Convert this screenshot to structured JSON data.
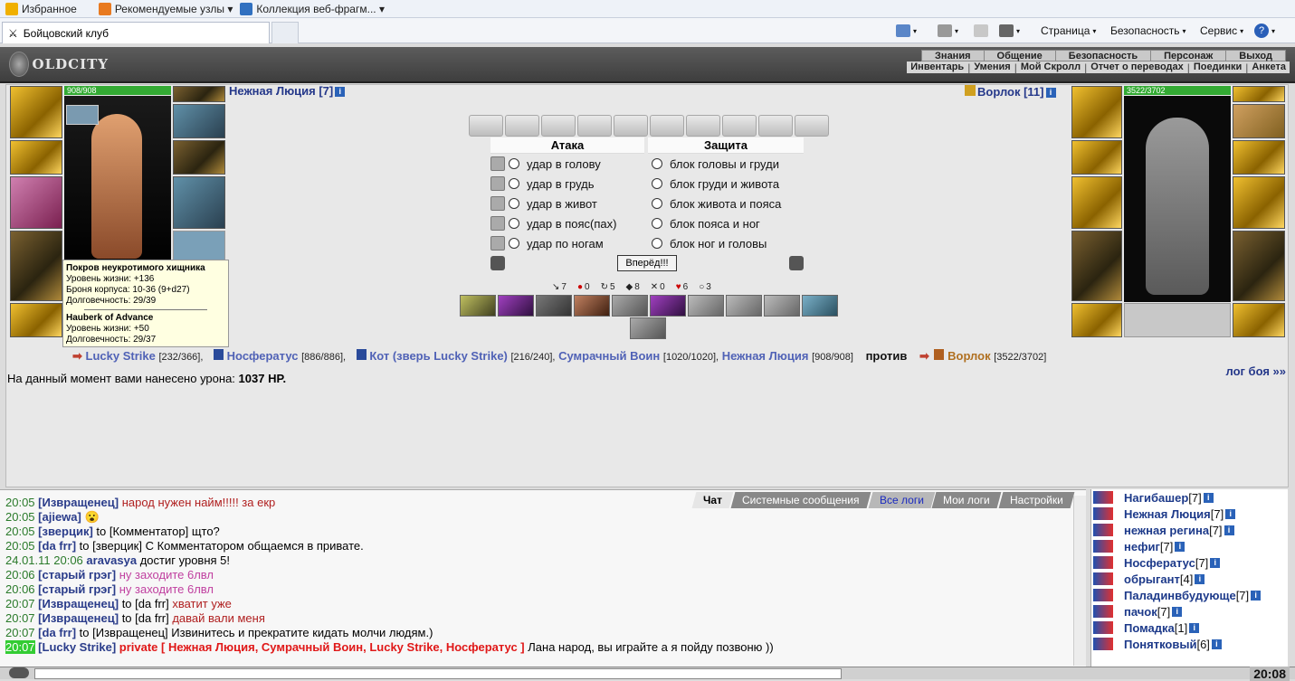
{
  "ie": {
    "favorites": "Избранное",
    "recommended": "Рекомендуемые узлы",
    "webslices": "Коллекция веб-фрагм...",
    "tab_title": "Бойцовский клуб",
    "cmd_page": "Страница",
    "cmd_security": "Безопасность",
    "cmd_service": "Сервис"
  },
  "game": {
    "logo": "OLDCITY",
    "menu_top": [
      "Знания",
      "Общение",
      "Безопасность",
      "Персонаж",
      "Выход"
    ],
    "menu_bottom": [
      "Инвентарь",
      "Умения",
      "Мой Скролл",
      "Отчет о переводах",
      "Поединки",
      "Анкета"
    ]
  },
  "player": {
    "name": "Нежная Люция [7]",
    "hp": "908/908"
  },
  "enemy": {
    "name": "Ворлок [11]",
    "hp": "3522/3702"
  },
  "combat": {
    "attack_header": "Атака",
    "defense_header": "Защита",
    "attacks": [
      "удар в голову",
      "удар в грудь",
      "удар в живот",
      "удар в пояс(пах)",
      "удар по ногам"
    ],
    "blocks": [
      "блок головы и груди",
      "блок груди и живота",
      "блок живота и пояса",
      "блок пояса и ног",
      "блок ног и головы"
    ],
    "go_button": "Вперёд!!!",
    "stats": [
      "7",
      "0",
      "5",
      "8",
      "0",
      "6",
      "3"
    ]
  },
  "tooltip": {
    "item1_title": "Покров неукротимого хищника",
    "item1_lines": [
      "Уровень жизни: +136",
      "Броня корпуса: 10-36 (9+d27)",
      "Долговечность: 29/39"
    ],
    "item2_title": "Hauberk of Advance",
    "item2_lines": [
      "Уровень жизни: +50",
      "Долговечность: 29/37"
    ]
  },
  "teams": {
    "allies": [
      {
        "name": "Lucky Strike",
        "hp": "[232/366],"
      },
      {
        "name": "Носфератус",
        "hp": "[886/886],"
      },
      {
        "name": "Кот (зверь Lucky Strike)",
        "hp": "[216/240],"
      },
      {
        "name": "Сумрачный Воин",
        "hp": "[1020/1020],"
      },
      {
        "name": "Нежная Люция",
        "hp": "[908/908]"
      }
    ],
    "vs": "против",
    "enemy_name": "Ворлок",
    "enemy_hp": "[3522/3702]",
    "log_link": "лог боя »»"
  },
  "damage": {
    "text": "На данный момент вами нанесено урона:",
    "value": "1037 HP."
  },
  "chat_tabs": [
    "Чат",
    "Системные сообщения",
    "Все логи",
    "Мои логи",
    "Настройки"
  ],
  "chat": [
    {
      "time": "20:05",
      "nick": "[Извращенец]",
      "to": "",
      "msg": " народ нужен найм!!!!! за екр",
      "cls": "red"
    },
    {
      "time": "20:05",
      "nick": "[ajiewa]",
      "to": "",
      "msg": " 😮",
      "cls": ""
    },
    {
      "time": "20:05",
      "nick": "[зверцик]",
      "to": " to [Комментатор]",
      "msg": " щто?",
      "cls": ""
    },
    {
      "time": "20:05",
      "nick": "[da frr]",
      "to": " to [зверцик]",
      "msg": " С Комментатором общаемся в привате.",
      "cls": ""
    },
    {
      "time": "24.01.11 20:06",
      "nick": "aravasya",
      "to": "",
      "msg": " достиг уровня 5!",
      "cls": ""
    },
    {
      "time": "20:06",
      "nick": "[старый грэг]",
      "to": "",
      "msg": " ну заходите 6лвл",
      "cls": "pink"
    },
    {
      "time": "20:06",
      "nick": "[старый грэг]",
      "to": "",
      "msg": " ну заходите 6лвл",
      "cls": "pink"
    },
    {
      "time": "20:07",
      "nick": "[Извращенец]",
      "to": " to [da frr]",
      "msg": " хватит уже",
      "cls": "red"
    },
    {
      "time": "20:07",
      "nick": "[Извращенец]",
      "to": " to [da frr]",
      "msg": " давай вали меня",
      "cls": "red"
    },
    {
      "time": "20:07",
      "nick": "[da frr]",
      "to": " to [Извращенец]",
      "msg": " Извинитесь и прекратите кидать молчи людям.)",
      "cls": ""
    },
    {
      "time": "20:07",
      "nick": "[Lucky Strike]",
      "to": "",
      "msg": " Лана народ, вы играйте а я пойду позвоню ))",
      "cls": "",
      "private": "private [ Нежная Люция, Сумрачный Воин, Lucky Strike, Носфератус ]"
    }
  ],
  "users": [
    {
      "name": "Нагибашер",
      "lv": "[7]"
    },
    {
      "name": "Нежная Люция",
      "lv": "[7]"
    },
    {
      "name": "нежная регина",
      "lv": "[7]"
    },
    {
      "name": "нефиг",
      "lv": "[7]"
    },
    {
      "name": "Носфератус",
      "lv": "[7]"
    },
    {
      "name": "обрыгант",
      "lv": "[4]"
    },
    {
      "name": "Паладинвбудующе",
      "lv": "[7]"
    },
    {
      "name": "пачок",
      "lv": "[7]"
    },
    {
      "name": "Помадка",
      "lv": "[1]"
    },
    {
      "name": "Понятковый",
      "lv": "[6]"
    }
  ],
  "clock": "20:08"
}
